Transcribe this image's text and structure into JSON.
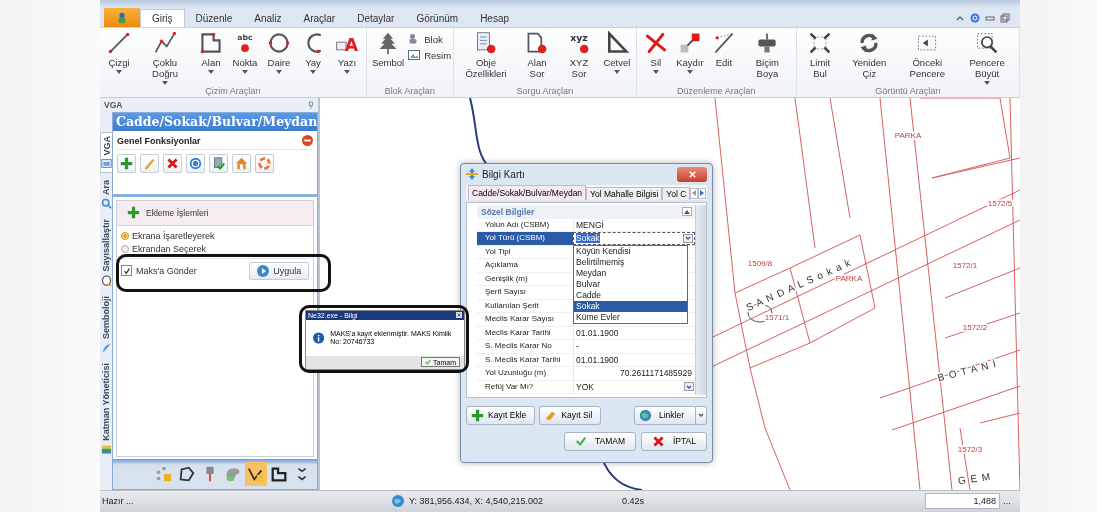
{
  "menu_tabs": [
    {
      "label": "Giriş",
      "selected": true
    },
    {
      "label": "Düzenle",
      "selected": false
    },
    {
      "label": "Analiz",
      "selected": false
    },
    {
      "label": "Araçlar",
      "selected": false
    },
    {
      "label": "Detaylar",
      "selected": false
    },
    {
      "label": "Görünüm",
      "selected": false
    },
    {
      "label": "Hesap",
      "selected": false
    }
  ],
  "ribbon": [
    {
      "title": "Çizim Araçları",
      "buttons": [
        {
          "label": "Çizgi",
          "kind": "line",
          "dropdown": true
        },
        {
          "label": "Çoklu Doğru",
          "kind": "polyline",
          "dropdown": true
        },
        {
          "label": "Alan",
          "kind": "area",
          "dropdown": true
        },
        {
          "label": "Nokta",
          "kind": "point",
          "icon_text": "abc",
          "dropdown": true
        },
        {
          "label": "Daire",
          "kind": "circle",
          "dropdown": true
        },
        {
          "label": "Yay",
          "kind": "arc",
          "dropdown": true
        },
        {
          "label": "Yazı",
          "kind": "text",
          "icon_text": "A",
          "dropdown": true
        }
      ]
    },
    {
      "title": "Blok Araçları",
      "buttons": [
        {
          "label": "Sembol",
          "kind": "symbol",
          "dropdown": false
        }
      ],
      "small_buttons": [
        {
          "label": "Blok",
          "kind": "block"
        },
        {
          "label": "Resim",
          "kind": "image"
        }
      ]
    },
    {
      "title": "Sorgu Araçları",
      "buttons": [
        {
          "label": "Obje Özellikleri",
          "kind": "properties",
          "dropdown": false
        },
        {
          "label": "Alan Sor",
          "kind": "area-query",
          "dropdown": false
        },
        {
          "label": "XYZ Sor",
          "kind": "xyz",
          "icon_text": "xyz",
          "dropdown": false
        },
        {
          "label": "Cetvel",
          "kind": "ruler",
          "dropdown": true
        }
      ]
    },
    {
      "title": "Düzenleme Araçları",
      "buttons": [
        {
          "label": "Sil",
          "kind": "delete",
          "dropdown": true
        },
        {
          "label": "Kaydır",
          "kind": "move",
          "dropdown": true
        },
        {
          "label": "Edit",
          "kind": "edit",
          "dropdown": false
        },
        {
          "label": "Biçim Boya",
          "kind": "format-paint",
          "dropdown": false
        }
      ]
    },
    {
      "title": "Görüntü Araçları",
      "buttons": [
        {
          "label": "Limit Bul",
          "kind": "limit",
          "dropdown": false
        },
        {
          "label": "Yeniden Çiz",
          "kind": "redraw",
          "dropdown": false
        },
        {
          "label": "Önceki Pencere",
          "kind": "previous-window",
          "dropdown": false
        },
        {
          "label": "Pencere Büyüt",
          "kind": "zoom-window",
          "dropdown": true
        }
      ]
    }
  ],
  "side_panel": {
    "title": "VGA",
    "vertical_tabs": [
      {
        "label": "VGA",
        "kind": "vga",
        "selected": true
      },
      {
        "label": "Ara",
        "kind": "search",
        "selected": false
      },
      {
        "label": "Sayısallaştır",
        "kind": "digitize",
        "selected": false
      },
      {
        "label": "Semboloji",
        "kind": "symbology",
        "selected": false
      },
      {
        "label": "Katman Yöneticisi",
        "kind": "layers",
        "selected": false
      }
    ],
    "banner": "Cadde/Sokak/Bulvar/Meydan",
    "general_title": "Genel Fonksiyonlar",
    "general_tools": [
      {
        "kind": "add"
      },
      {
        "kind": "edit"
      },
      {
        "kind": "delete"
      },
      {
        "kind": "help"
      },
      {
        "kind": "refresh"
      },
      {
        "kind": "home"
      },
      {
        "kind": "lifebuoy"
      }
    ],
    "section_title": "Ekleme İşlemleri",
    "radios": [
      {
        "label": "Ekrana İşaretleyerek",
        "selected": true
      },
      {
        "label": "Ekrandan Seçerek",
        "selected": false
      }
    ],
    "checkbox": {
      "label": "Maks'a Gönder",
      "checked": true
    },
    "apply_button": "Uygula",
    "bottom_tools": [
      {
        "kind": "points",
        "selected": false
      },
      {
        "kind": "polygon-draw",
        "selected": false
      },
      {
        "kind": "pin",
        "selected": false
      },
      {
        "kind": "shape",
        "selected": false
      },
      {
        "kind": "vertex",
        "selected": true
      },
      {
        "kind": "polygon-edit",
        "selected": false
      },
      {
        "kind": "overflow",
        "selected": false
      }
    ]
  },
  "map_labels": [
    "S A N D A L   S o k a k",
    "B O T A N İ",
    "G E M",
    "PARKA",
    "PARKA",
    "1572/5",
    "1509/8",
    "1572/1",
    "1571/1",
    "1572/2",
    "1572/3"
  ],
  "dialog": {
    "title": "Bilgi Kartı",
    "tabs": [
      {
        "label": "Cadde/Sokak/Bulvar/Meydan",
        "selected": true
      },
      {
        "label": "Yol Mahalle Bilgisi",
        "selected": false
      },
      {
        "label": "Yol C",
        "selected": false
      }
    ],
    "group_title": "Sözel Bilgiler",
    "rows": [
      {
        "label": "Yolun Adı (CSBM)",
        "value": "MENGİ",
        "kind": "text",
        "selected": false
      },
      {
        "label": "Yol Türü (CSBM)",
        "value": "Sokak",
        "kind": "combo",
        "selected": true,
        "expanded": true,
        "options": [
          {
            "label": "Köyün Kendisi",
            "selected": false
          },
          {
            "label": "Belirtilmemiş",
            "selected": false
          },
          {
            "label": "Meydan",
            "selected": false
          },
          {
            "label": "Bulvar",
            "selected": false
          },
          {
            "label": "Cadde",
            "selected": false
          },
          {
            "label": "Sokak",
            "selected": true
          },
          {
            "label": "Küme Evler",
            "selected": false
          }
        ]
      },
      {
        "label": "Yol Tipi",
        "kind": "text",
        "selected": false
      },
      {
        "label": "Açıklama",
        "kind": "text",
        "selected": false
      },
      {
        "label": "Genişlik (m)",
        "kind": "text",
        "selected": false
      },
      {
        "label": "Şerit Sayısı",
        "kind": "text",
        "selected": false
      },
      {
        "label": "Kullanılan Şerit",
        "kind": "text",
        "selected": false
      },
      {
        "label": "Meclis Karar Sayısı",
        "kind": "text",
        "selected": false
      },
      {
        "label": "Meclis Karar Tarihi",
        "value": "01.01.1900",
        "kind": "text",
        "selected": false
      },
      {
        "label": "S. Meclis Karar No",
        "value": "-",
        "kind": "text",
        "selected": false
      },
      {
        "label": "S. Meclis Karar Tarihi",
        "value": "01.01.1900",
        "kind": "text",
        "selected": false
      },
      {
        "label": "Yol Uzunluğu (m)",
        "value": "70.2611171485929",
        "kind": "number",
        "selected": false
      },
      {
        "label": "Refüj Var Mı?",
        "value": "YOK",
        "kind": "combo",
        "selected": false,
        "expanded": false
      }
    ],
    "record_buttons": [
      {
        "label": "Kayıt Ekle",
        "kind": "add"
      },
      {
        "label": "Kayıt Sil",
        "kind": "erase"
      },
      {
        "label": "Linkler",
        "kind": "links"
      }
    ],
    "ok": "TAMAM",
    "cancel": "İPTAL"
  },
  "message_box": {
    "title": "Ne32.exe - Bilgi",
    "text": "MAKS'a kayıt eklenmiştir. MAKS Kimlik No: 20746733",
    "button": "Tamam"
  },
  "status_bar": {
    "state": "Hazır ...",
    "coordinates": "Y: 381,956.434, X: 4,540,215.002",
    "time": "0.42s",
    "scale": "1,488",
    "scale_button": "..."
  }
}
